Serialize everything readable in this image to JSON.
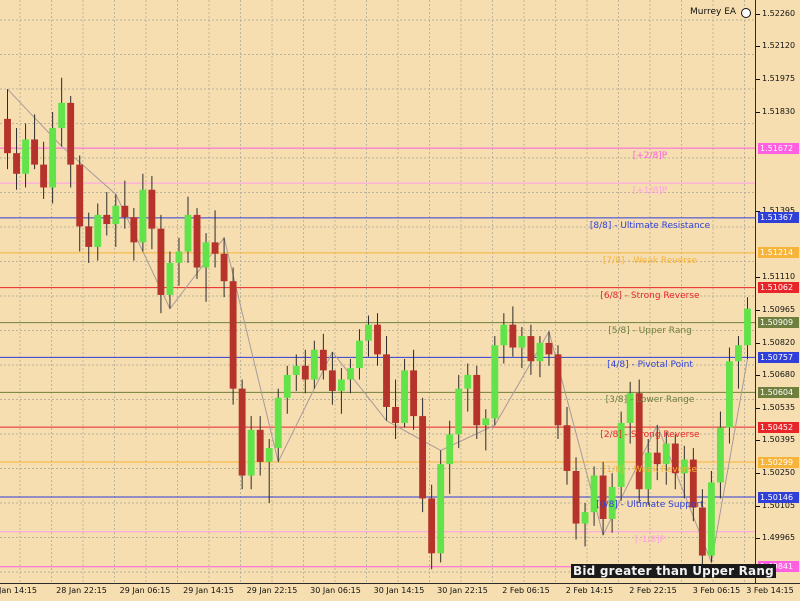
{
  "window": {
    "indicator_name": "Murrey EA"
  },
  "price_axis": {
    "ticks": [
      {
        "label": "1.52260",
        "price": 1.5226
      },
      {
        "label": "1.52120",
        "price": 1.5212
      },
      {
        "label": "1.51975",
        "price": 1.51975
      },
      {
        "label": "1.51830",
        "price": 1.5183
      },
      {
        "label": "1.51395",
        "price": 1.51395
      },
      {
        "label": "1.51110",
        "price": 1.5111
      },
      {
        "label": "1.50965",
        "price": 1.50965
      },
      {
        "label": "1.50820",
        "price": 1.5082
      },
      {
        "label": "1.50680",
        "price": 1.5068
      },
      {
        "label": "1.50535",
        "price": 1.50535
      },
      {
        "label": "1.50395",
        "price": 1.50395
      },
      {
        "label": "1.50250",
        "price": 1.5025
      },
      {
        "label": "1.50105",
        "price": 1.50105
      },
      {
        "label": "1.49965",
        "price": 1.49965
      }
    ],
    "badges": [
      {
        "label": "1.51672",
        "price": 1.51672,
        "bg": "#ff5fe0",
        "fg": "#ffffff"
      },
      {
        "label": "1.51367",
        "price": 1.51367,
        "bg": "#2f3fd8",
        "fg": "#ffffff"
      },
      {
        "label": "1.51214",
        "price": 1.51214,
        "bg": "#f7b43a",
        "fg": "#ffffff"
      },
      {
        "label": "1.51062",
        "price": 1.51062,
        "bg": "#e8262a",
        "fg": "#ffffff"
      },
      {
        "label": "1.50909",
        "price": 1.50909,
        "bg": "#6f7f3e",
        "fg": "#ffffff"
      },
      {
        "label": "1.50757",
        "price": 1.50757,
        "bg": "#2f3fd8",
        "fg": "#ffffff"
      },
      {
        "label": "1.50604",
        "price": 1.50604,
        "bg": "#6f7f3e",
        "fg": "#ffffff"
      },
      {
        "label": "1.50452",
        "price": 1.50452,
        "bg": "#e8262a",
        "fg": "#ffffff"
      },
      {
        "label": "1.50299",
        "price": 1.50299,
        "bg": "#f7b43a",
        "fg": "#ffffff"
      },
      {
        "label": "1.50146",
        "price": 1.50146,
        "bg": "#2f3fd8",
        "fg": "#ffffff"
      },
      {
        "label": "1.49841",
        "price": 1.49841,
        "bg": "#ff5fe0",
        "fg": "#ffffff"
      }
    ]
  },
  "murrey_levels": [
    {
      "label": "[+2/8]P",
      "price": 1.51672,
      "color": "#ff5fe0"
    },
    {
      "label": "[+1/8]P",
      "price": 1.51519,
      "color": "#ff9fe8"
    },
    {
      "label": "[8/8] - Ultimate Resistance",
      "price": 1.51367,
      "color": "#2f3fd8"
    },
    {
      "label": "[7/8] - Weak Reverse",
      "price": 1.51214,
      "color": "#f7b43a"
    },
    {
      "label": "[6/8] - Strong Reverse",
      "price": 1.51062,
      "color": "#e8262a"
    },
    {
      "label": "[5/8] - Upper Rang",
      "price": 1.50909,
      "color": "#6f7f3e"
    },
    {
      "label": "[4/8] - Pivotal Point",
      "price": 1.50757,
      "color": "#2f3fd8"
    },
    {
      "label": "[3/8] - Lower Range",
      "price": 1.50604,
      "color": "#6f7f3e"
    },
    {
      "label": "[2/8] - Strong Reverse",
      "price": 1.50452,
      "color": "#e8262a"
    },
    {
      "label": "[1/8] - Weak Reverse",
      "price": 1.50299,
      "color": "#f7b43a"
    },
    {
      "label": "[0/8] - Ultimate Support",
      "price": 1.50146,
      "color": "#2f3fd8"
    },
    {
      "label": "[-1/8]P",
      "price": 1.49994,
      "color": "#ff9fe8"
    },
    {
      "label": "[-2/8]P",
      "price": 1.49841,
      "color": "#ff5fe0"
    }
  ],
  "time_axis": {
    "ticks": [
      "Jan 14:15",
      "28 Jan 22:15",
      "29 Jan 06:15",
      "29 Jan 14:15",
      "29 Jan 22:15",
      "30 Jan 06:15",
      "30 Jan 14:15",
      "30 Jan 22:15",
      "2 Feb 06:15",
      "2 Feb 14:15",
      "2 Feb 22:15",
      "3 Feb 06:15",
      "3 Feb 14:15"
    ]
  },
  "status": {
    "message": "Bid greater than Upper Rang"
  },
  "colors": {
    "background": "#f6deb0",
    "grid": "#a6a695",
    "bull": "#62e34a",
    "bear": "#b5332a",
    "wick": "#2b2b2b"
  },
  "price_range": {
    "min": 1.4977,
    "max": 1.5232
  },
  "candles": [
    [
      1.518,
      1.5193,
      1.5158,
      1.5165
    ],
    [
      1.5165,
      1.5176,
      1.5149,
      1.5156
    ],
    [
      1.5156,
      1.5178,
      1.515,
      1.5171
    ],
    [
      1.5171,
      1.5182,
      1.5158,
      1.516
    ],
    [
      1.516,
      1.517,
      1.5145,
      1.515
    ],
    [
      1.515,
      1.5183,
      1.5143,
      1.5176
    ],
    [
      1.5176,
      1.5198,
      1.5168,
      1.5187
    ],
    [
      1.5187,
      1.519,
      1.515,
      1.516
    ],
    [
      1.516,
      1.5164,
      1.5122,
      1.5133
    ],
    [
      1.5133,
      1.5139,
      1.5117,
      1.5124
    ],
    [
      1.5124,
      1.5143,
      1.5118,
      1.5138
    ],
    [
      1.5138,
      1.5148,
      1.5129,
      1.5134
    ],
    [
      1.5134,
      1.5147,
      1.5124,
      1.5142
    ],
    [
      1.5142,
      1.5153,
      1.5132,
      1.5137
    ],
    [
      1.5137,
      1.5141,
      1.5118,
      1.5126
    ],
    [
      1.5126,
      1.5156,
      1.5122,
      1.5149
    ],
    [
      1.5149,
      1.5155,
      1.5123,
      1.5132
    ],
    [
      1.5132,
      1.5138,
      1.5095,
      1.5103
    ],
    [
      1.5103,
      1.5122,
      1.5097,
      1.5117
    ],
    [
      1.5117,
      1.5128,
      1.5107,
      1.5122
    ],
    [
      1.5122,
      1.5146,
      1.5117,
      1.5138
    ],
    [
      1.5138,
      1.5141,
      1.511,
      1.5115
    ],
    [
      1.5115,
      1.513,
      1.51,
      1.5126
    ],
    [
      1.5126,
      1.514,
      1.5115,
      1.5121
    ],
    [
      1.5121,
      1.5128,
      1.5102,
      1.5109
    ],
    [
      1.5109,
      1.5115,
      1.5055,
      1.5062
    ],
    [
      1.5062,
      1.5066,
      1.5018,
      1.5024
    ],
    [
      1.5024,
      1.505,
      1.5018,
      1.5044
    ],
    [
      1.5044,
      1.505,
      1.5024,
      1.503
    ],
    [
      1.503,
      1.504,
      1.5012,
      1.5036
    ],
    [
      1.5036,
      1.5062,
      1.503,
      1.5058
    ],
    [
      1.5058,
      1.5072,
      1.5051,
      1.5068
    ],
    [
      1.5068,
      1.5077,
      1.5061,
      1.5072
    ],
    [
      1.5072,
      1.5079,
      1.506,
      1.5066
    ],
    [
      1.5066,
      1.5083,
      1.5062,
      1.5079
    ],
    [
      1.5079,
      1.5086,
      1.5066,
      1.507
    ],
    [
      1.507,
      1.5078,
      1.5055,
      1.5061
    ],
    [
      1.5061,
      1.5071,
      1.5051,
      1.5066
    ],
    [
      1.5066,
      1.5075,
      1.506,
      1.5071
    ],
    [
      1.5071,
      1.5088,
      1.5066,
      1.5083
    ],
    [
      1.5083,
      1.5094,
      1.5076,
      1.509
    ],
    [
      1.509,
      1.5095,
      1.5072,
      1.5077
    ],
    [
      1.5077,
      1.5085,
      1.5048,
      1.5054
    ],
    [
      1.5054,
      1.5066,
      1.504,
      1.5047
    ],
    [
      1.5047,
      1.5075,
      1.5045,
      1.507
    ],
    [
      1.507,
      1.5079,
      1.5044,
      1.505
    ],
    [
      1.505,
      1.5058,
      1.5008,
      1.5014
    ],
    [
      1.5014,
      1.502,
      1.4983,
      1.499
    ],
    [
      1.499,
      1.5035,
      1.4986,
      1.5029
    ],
    [
      1.5029,
      1.5048,
      1.5016,
      1.5042
    ],
    [
      1.5042,
      1.5068,
      1.5036,
      1.5062
    ],
    [
      1.5062,
      1.5073,
      1.5052,
      1.5068
    ],
    [
      1.5068,
      1.5072,
      1.504,
      1.5046
    ],
    [
      1.5046,
      1.5053,
      1.5035,
      1.5049
    ],
    [
      1.5049,
      1.5085,
      1.5046,
      1.5081
    ],
    [
      1.5081,
      1.5095,
      1.5073,
      1.509
    ],
    [
      1.509,
      1.5098,
      1.5076,
      1.508
    ],
    [
      1.508,
      1.5089,
      1.5071,
      1.5085
    ],
    [
      1.5085,
      1.509,
      1.5068,
      1.5074
    ],
    [
      1.5074,
      1.5085,
      1.5067,
      1.5082
    ],
    [
      1.5082,
      1.5087,
      1.5072,
      1.5077
    ],
    [
      1.5077,
      1.5081,
      1.504,
      1.5046
    ],
    [
      1.5046,
      1.5054,
      1.502,
      1.5026
    ],
    [
      1.5026,
      1.5032,
      1.4996,
      1.5003
    ],
    [
      1.5003,
      1.5012,
      1.4993,
      1.5008
    ],
    [
      1.5008,
      1.5028,
      1.5002,
      1.5024
    ],
    [
      1.5024,
      1.503,
      1.4998,
      1.5005
    ],
    [
      1.5005,
      1.5025,
      1.4999,
      1.5019
    ],
    [
      1.5019,
      1.5052,
      1.5013,
      1.5047
    ],
    [
      1.5047,
      1.5065,
      1.5038,
      1.506
    ],
    [
      1.506,
      1.5066,
      1.5012,
      1.5018
    ],
    [
      1.5018,
      1.504,
      1.5011,
      1.5034
    ],
    [
      1.5034,
      1.5046,
      1.5022,
      1.5029
    ],
    [
      1.5029,
      1.5043,
      1.502,
      1.5038
    ],
    [
      1.5038,
      1.5042,
      1.5018,
      1.5025
    ],
    [
      1.5025,
      1.5037,
      1.5014,
      1.5031
    ],
    [
      1.5031,
      1.5036,
      1.5004,
      1.501
    ],
    [
      1.501,
      1.5018,
      1.4983,
      1.4989
    ],
    [
      1.4989,
      1.5026,
      1.4986,
      1.5021
    ],
    [
      1.5021,
      1.5052,
      1.5014,
      1.5045
    ],
    [
      1.5045,
      1.508,
      1.5038,
      1.5074
    ],
    [
      1.5074,
      1.5085,
      1.5062,
      1.5081
    ],
    [
      1.5081,
      1.5102,
      1.5075,
      1.5097
    ]
  ]
}
